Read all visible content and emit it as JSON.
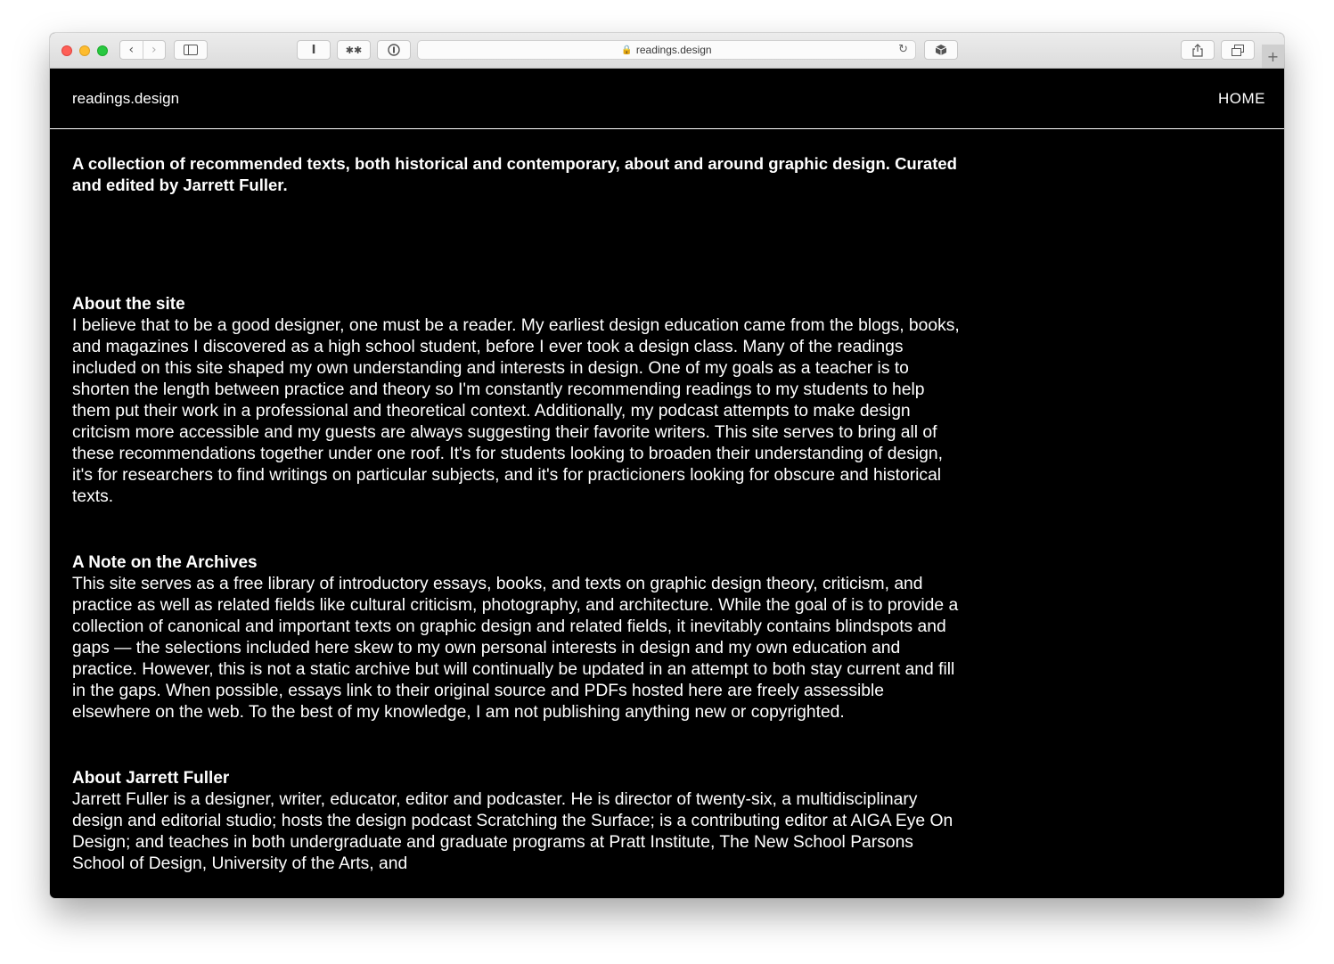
{
  "browser": {
    "url": "readings.design"
  },
  "header": {
    "logo": "readings.design",
    "nav_home": "HOME"
  },
  "tagline": "A collection of recommended texts, both historical and contemporary, about and around graphic design. Curated and edited by Jarrett Fuller.",
  "sections": [
    {
      "title": "About the site",
      "body": "I believe that to be a good designer, one must be a reader. My earliest design education came from the blogs, books, and magazines I discovered as a high school student, before I ever took a design class. Many of the readings included on this site shaped my own understanding and interests in design. One of my goals as a teacher is to shorten the length between practice and theory so I'm constantly recommending readings to my students to help them put their work in a professional and theoretical context. Additionally, my podcast attempts to make design critcism more accessible and my guests are always suggesting their favorite writers. This site serves to bring all of these recommendations together under one roof. It's for students looking to broaden their understanding of design, it's for researchers to find writings on particular subjects, and it's for practicioners looking for obscure and historical texts."
    },
    {
      "title": "A Note on the Archives",
      "body": "This site serves as a free library of introductory essays, books, and texts on graphic design theory, criticism, and practice as well as related fields like cultural criticism, photography, and architecture. While the goal of is to provide a collection of canonical and important texts on graphic design and related fields, it inevitably contains blindspots and gaps — the selections included here skew to my own personal interests in design and my own education and practice. However, this is not a static archive but will continually be updated in an attempt to both stay current and fill in the gaps. When possible, essays link to their original source and PDFs hosted here are freely assessible elsewhere on the web. To the best of my knowledge, I am not publishing anything new or copyrighted."
    },
    {
      "title": "About Jarrett Fuller",
      "body": "Jarrett Fuller is a designer, writer, educator, editor and podcaster. He is director of twenty-six, a multidisciplinary design and editorial studio; hosts the design podcast Scratching the Surface; is a contributing editor at AIGA Eye On Design; and teaches in both undergraduate and graduate programs at Pratt Institute, The New School Parsons School of Design, University of the Arts, and"
    }
  ]
}
